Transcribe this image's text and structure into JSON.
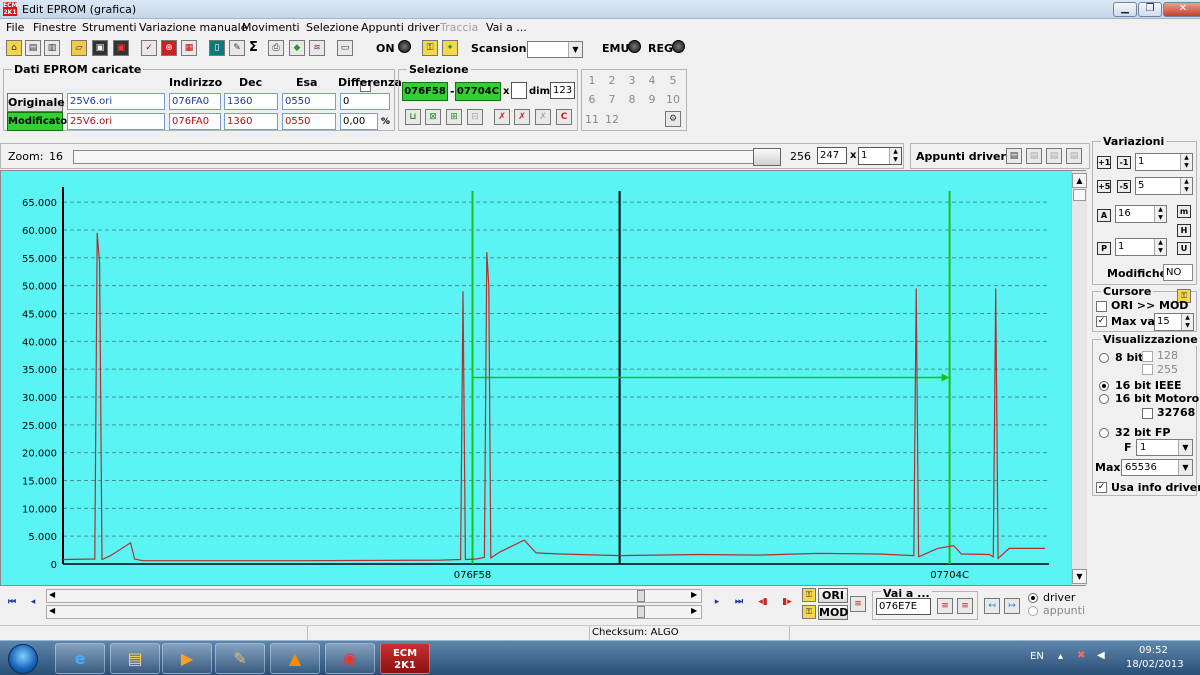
{
  "window": {
    "title": "Edit EPROM (grafica)",
    "app_icon_text": "ECM 2K1"
  },
  "menu": [
    "File",
    "Finestre",
    "Strumenti",
    "Variazione manuale",
    "Movimenti",
    "Selezione",
    "Appunti driver",
    "Traccia",
    "Vai a ..."
  ],
  "menu_disabled": [
    "Traccia"
  ],
  "toolbar": {
    "on_label": "ON",
    "scansione_label": "Scansione",
    "scansione_value": "",
    "emu_label": "EMU",
    "reg_label": "REG",
    "sigma": "Σ"
  },
  "eprom": {
    "group_label": "Dati EPROM caricate",
    "headers": {
      "indirizzo": "Indirizzo",
      "dec": "Dec",
      "esa": "Esa",
      "differenza": "Differenza"
    },
    "originale": {
      "label": "Originale",
      "file": "25V6.ori",
      "indirizzo": "076FA0",
      "dec": "1360",
      "esa": "0550",
      "differenza": "0"
    },
    "modificato": {
      "label": "Modificato",
      "file": "25V6.ori",
      "indirizzo": "076FA0",
      "dec": "1360",
      "esa": "0550",
      "differenza": "0,00",
      "pct": "%"
    }
  },
  "selezione": {
    "group_label": "Selezione",
    "start": "076F58",
    "end": "07704C",
    "sep": "-",
    "x_label": "x",
    "x_value": "",
    "dim_label": "dim.",
    "dim_value": "123",
    "grid": [
      "1",
      "2",
      "3",
      "4",
      "5",
      "6",
      "7",
      "8",
      "9",
      "10",
      "11",
      "12"
    ]
  },
  "zoom": {
    "label": "Zoom:",
    "value": "16",
    "max": "256",
    "field": "247",
    "x_label": "x",
    "multiplier": "1"
  },
  "appunti": {
    "label": "Appunti driver:"
  },
  "variazioni": {
    "group_label": "Variazioni",
    "v1": "1",
    "v2": "5",
    "a": "16",
    "p": "1",
    "modifiche_label": "Modifiche:",
    "modifiche_value": "NO"
  },
  "cursore": {
    "group_label": "Cursore",
    "ori_mod": "ORI >> MOD",
    "max_var_label": "Max var",
    "max_var_value": "15",
    "max_var_checked": true
  },
  "visualizzazione": {
    "group_label": "Visualizzazione",
    "options": [
      "8 bit",
      "16 bit IEEE",
      "16 bit Motorola",
      "32 bit FP"
    ],
    "selected": "16 bit IEEE",
    "extra_128": "128",
    "extra_255": "255",
    "extra_32768": "32768",
    "f_label": "F",
    "f_value": "1",
    "max_label": "Max",
    "max_value": "65536",
    "usa_info": "Usa info driver",
    "usa_info_checked": true
  },
  "chart_data": {
    "type": "line",
    "yticks": [
      "65.000",
      "60.000",
      "55.000",
      "50.000",
      "45.000",
      "40.000",
      "35.000",
      "30.000",
      "25.000",
      "20.000",
      "15.000",
      "10.000",
      "5.000",
      "0"
    ],
    "ylim": [
      0,
      67000
    ],
    "xlim": [
      0,
      248
    ],
    "x_tick_labels": [
      {
        "x": 103,
        "label": "076F58"
      },
      {
        "x": 223,
        "label": "07704C"
      }
    ],
    "green_markers": [
      103,
      223
    ],
    "black_marker": 140,
    "arrow": {
      "x1": 103,
      "x2": 223,
      "y": 33500
    },
    "series": [
      {
        "values": [
          [
            0,
            800
          ],
          [
            8,
            900
          ],
          [
            8.6,
            59500
          ],
          [
            9.2,
            54000
          ],
          [
            9.8,
            800
          ],
          [
            12,
            1500
          ],
          [
            17,
            3800
          ],
          [
            18,
            900
          ],
          [
            20,
            600
          ],
          [
            60,
            600
          ],
          [
            95,
            700
          ],
          [
            100,
            800
          ],
          [
            100.6,
            49000
          ],
          [
            101.2,
            800
          ],
          [
            104,
            900
          ],
          [
            106,
            1200
          ],
          [
            106.6,
            56000
          ],
          [
            107.1,
            50000
          ],
          [
            107.6,
            1100
          ],
          [
            110,
            2200
          ],
          [
            116,
            4300
          ],
          [
            119,
            2000
          ],
          [
            125,
            1800
          ],
          [
            140,
            1500
          ],
          [
            160,
            1700
          ],
          [
            175,
            1600
          ],
          [
            190,
            1900
          ],
          [
            205,
            1800
          ],
          [
            214,
            1500
          ],
          [
            214.6,
            49500
          ],
          [
            215.2,
            1300
          ],
          [
            220,
            2800
          ],
          [
            224,
            3300
          ],
          [
            226,
            1800
          ],
          [
            233,
            1700
          ],
          [
            234,
            1300
          ],
          [
            234.6,
            49500
          ],
          [
            235.2,
            1000
          ],
          [
            238,
            2800
          ],
          [
            247,
            2800
          ]
        ]
      }
    ]
  },
  "nav": {
    "ori_label": "ORI",
    "mod_label": "MOD",
    "vai_label": "Vai a ...",
    "vai_value": "076E7E",
    "driver_label": "driver",
    "appunti_label": "appunti"
  },
  "status": {
    "checksum": "Checksum: ALGO"
  },
  "taskbar": {
    "lang": "EN",
    "time": "09:52",
    "date": "18/02/2013",
    "ecm_label": "ECM 2K1"
  }
}
